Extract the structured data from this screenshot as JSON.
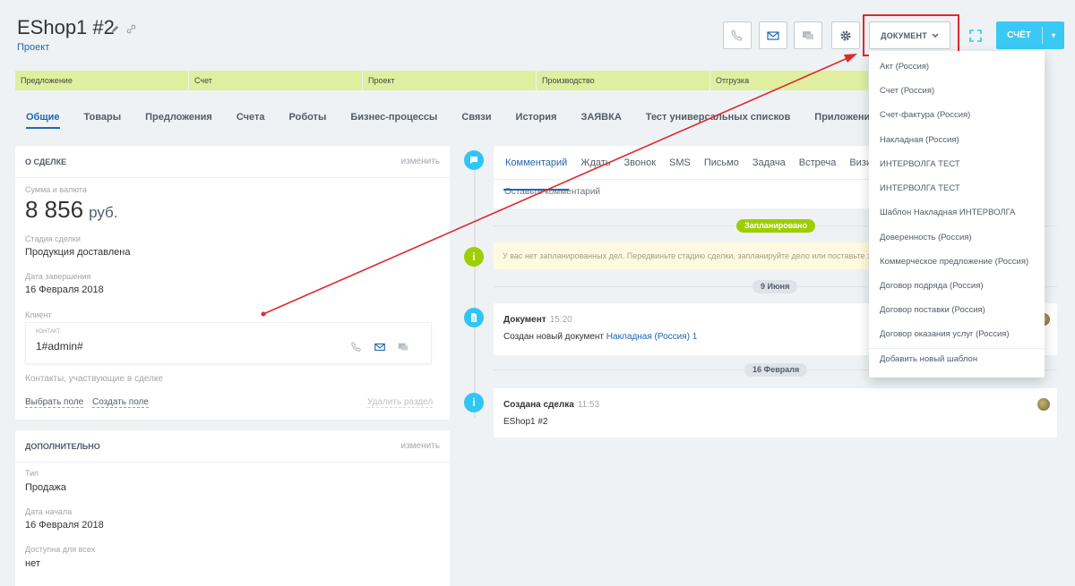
{
  "header": {
    "title": "EShop1 #2",
    "breadcrumb": "Проект",
    "document_button": "ДОКУМЕНТ",
    "schet_button": "СЧЁТ"
  },
  "stages": [
    "Предложение",
    "Счет",
    "Проект",
    "Производство",
    "Отгрузка"
  ],
  "tabs": [
    "Общие",
    "Товары",
    "Предложения",
    "Счета",
    "Роботы",
    "Бизнес-процессы",
    "Связи",
    "История",
    "ЗАЯВКА",
    "Тест универсальных списков",
    "Приложения"
  ],
  "deal_card": {
    "title": "О СДЕЛКЕ",
    "edit": "изменить",
    "amount_label": "Сумма и валюта",
    "amount": "8 856",
    "currency": "руб.",
    "stage_label": "Стадия сделки",
    "stage_value": "Продукция доставлена",
    "close_label": "Дата завершения",
    "close_value": "16 Февраля 2018",
    "client_label": "Клиент",
    "contact_label": "КОНТАКТ",
    "contact_value": "1#admin#",
    "participants_label": "Контакты, участвующие в сделке",
    "select_field": "Выбрать поле",
    "create_field": "Создать поле",
    "delete_section": "Удалить раздел"
  },
  "extra_card": {
    "title": "ДОПОЛНИТЕЛЬНО",
    "edit": "изменить",
    "type_label": "Тип",
    "type_value": "Продажа",
    "start_label": "Дата начала",
    "start_value": "16 Февраля 2018",
    "public_label": "Доступна для всех",
    "public_value": "нет"
  },
  "editor": {
    "tabs": [
      "Комментарий",
      "Ждать",
      "Звонок",
      "SMS",
      "Письмо",
      "Задача",
      "Встреча",
      "Визит"
    ],
    "placeholder": "Оставьте комментарий"
  },
  "timeline": {
    "planned": "Запланировано",
    "notice": "У вас нет запланированных дел. Передвиньте стадию сделки, запланируйте дело или поставьте задачу",
    "date1": "9 Июня",
    "doc_title": "Документ",
    "doc_time": "15:20",
    "doc_text": "Создан новый документ",
    "doc_link": "Накладная (Россия) 1",
    "date2": "16 Февраля",
    "created_title": "Создана сделка",
    "created_time": "11:53",
    "created_text": "EShop1 #2"
  },
  "dropdown": {
    "items": [
      "Акт (Россия)",
      "Счет (Россия)",
      "Счет-фактура (Россия)",
      "Накладная (Россия)",
      "ИНТЕРВОЛГА ТЕСТ",
      "ИНТЕРВОЛГА ТЕСТ",
      "Шаблон Накладная ИНТЕРВОЛГА",
      "Доверенность (Россия)",
      "Коммерческое предложение (Россия)",
      "Договор подряда (Россия)",
      "Договор поставки (Россия)",
      "Договор оказания услуг (Россия)"
    ],
    "add_template": "Добавить новый шаблон"
  },
  "colors": {
    "accent": "#2067b0",
    "stage": "#dfef9f",
    "highlight": "#e0282d",
    "button_blue": "#3bc8f5"
  }
}
